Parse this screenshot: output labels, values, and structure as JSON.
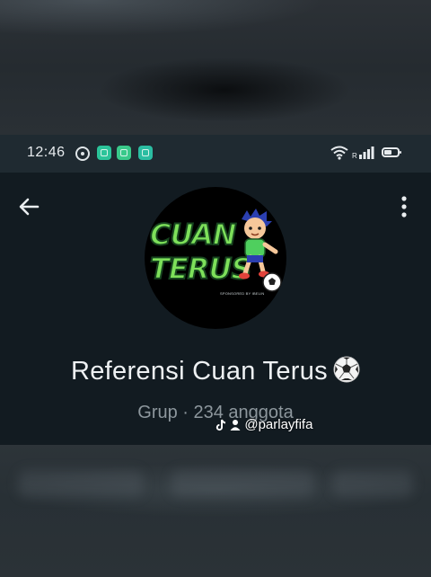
{
  "status_bar": {
    "time": "12:46",
    "network_label": "R",
    "icons": [
      "whatsapp-icon",
      "notification-app-icon",
      "notification-app-icon",
      "shield-app-icon",
      "wifi-icon",
      "signal-icon",
      "battery-icon"
    ]
  },
  "header": {
    "back_icon": "arrow-left-icon",
    "menu_icon": "more-vertical-icon"
  },
  "group": {
    "avatar_logo_line1": "CUAN",
    "avatar_logo_line2": "TERUS",
    "avatar_sponsor_text": "SPONSORED BY IBELIN",
    "name": "Referensi Cuan Terus",
    "name_emoji": "soccer-ball-icon",
    "subtitle": "Grup · 234 anggota"
  },
  "watermark": {
    "text": "@parlayfifa",
    "icons": [
      "tiktok-icon",
      "user-icon"
    ]
  },
  "colors": {
    "status_bar_bg": "#1f2a31",
    "profile_bg": "#121b21",
    "logo_green": "#7de05a",
    "subtitle_gray": "#8d979d"
  }
}
